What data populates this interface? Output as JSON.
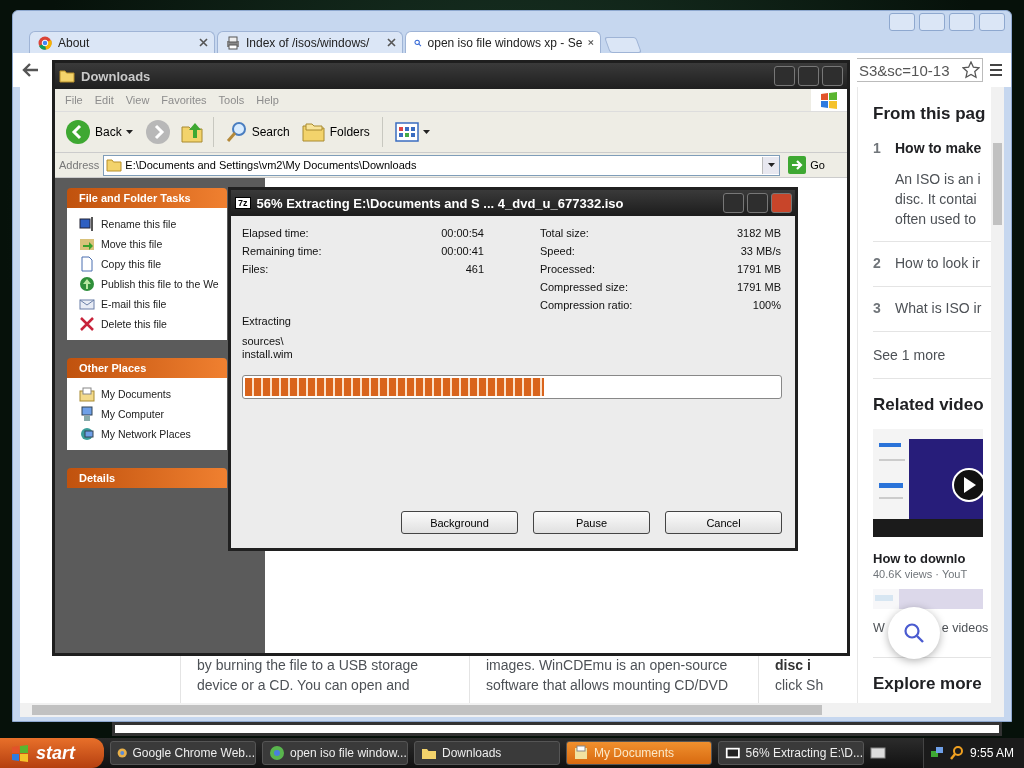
{
  "browser": {
    "tabs": [
      {
        "title": "About",
        "selected": false
      },
      {
        "title": "Index of /isos/windows/",
        "selected": false
      },
      {
        "title": "open iso file windows xp - Se",
        "selected": true
      }
    ],
    "address": "S3&sc=10-13",
    "page": {
      "snippets": [
        {
          "lines": [
            {
              "text": "by burning the file to a USB storage",
              "bold": false
            },
            {
              "text": "device or a CD. You can open and",
              "bold": false
            }
          ]
        },
        {
          "lines": [
            {
              "text": "images. WinCDEmu is an open-source",
              "bold": false
            },
            {
              "text": "software that allows mounting CD/DVD",
              "bold": false
            }
          ]
        },
        {
          "lines": [
            {
              "text": "disc i",
              "bold": true
            },
            {
              "text": "click Sh",
              "bold": false
            }
          ]
        }
      ],
      "sidebar": {
        "heading": "From this pag",
        "items": [
          {
            "number": "1",
            "title": "How to make",
            "expanded": true,
            "text": [
              "An ISO is an i",
              "disc. It contai",
              "often used to"
            ]
          },
          {
            "number": "2",
            "title": "How to look ir",
            "expanded": false
          },
          {
            "number": "3",
            "title": "What is ISO ir",
            "expanded": false
          }
        ],
        "more": "See 1 more",
        "videos_heading": "Related video",
        "video": {
          "kind": "picture",
          "title": "How to downlo",
          "meta": "40.6K views · YouT"
        },
        "videos_link": [
          "W",
          "e videos"
        ],
        "explore": "Explore more"
      }
    }
  },
  "explorer": {
    "title": "Downloads",
    "menu": [
      "File",
      "Edit",
      "View",
      "Favorites",
      "Tools",
      "Help"
    ],
    "toolbar": {
      "back": "Back",
      "search": "Search",
      "folders": "Folders"
    },
    "address_label": "Address",
    "address": "E:\\Documents and Settings\\vm2\\My Documents\\Downloads",
    "go": "Go",
    "panels": [
      {
        "title": "File and Folder Tasks",
        "items": [
          "Rename this file",
          "Move this file",
          "Copy this file",
          "Publish this file to the We",
          "E-mail this file",
          "Delete this file"
        ]
      },
      {
        "title": "Other Places",
        "items": [
          "My Documents",
          "My Computer",
          "My Network Places"
        ]
      },
      {
        "title": "Details"
      }
    ]
  },
  "dialog": {
    "badge": "7z",
    "title": "56% Extracting E:\\Documents and S ... 4_dvd_u_677332.iso",
    "stats_left": [
      {
        "label": "Elapsed time:",
        "value": "00:00:54"
      },
      {
        "label": "Remaining time:",
        "value": "00:00:41"
      },
      {
        "label": "Files:",
        "value": "461"
      }
    ],
    "stats_right": [
      {
        "label": "Total size:",
        "value": "3182 MB"
      },
      {
        "label": "Speed:",
        "value": "33 MB/s"
      },
      {
        "label": "Processed:",
        "value": "1791 MB"
      },
      {
        "label": "Compressed size:",
        "value": "1791 MB"
      },
      {
        "label": "Compression ratio:",
        "value": "100%"
      }
    ],
    "status": "Extracting",
    "path": [
      "sources\\",
      "install.wim"
    ],
    "progress": {
      "level": 0.56
    },
    "buttons": [
      "Background",
      "Pause",
      "Cancel"
    ]
  },
  "taskbar": {
    "start": "start",
    "items": [
      {
        "label": "Google Chrome Web...",
        "selected": false
      },
      {
        "label": "open iso file window...",
        "selected": false
      },
      {
        "label": "Downloads",
        "selected": false
      },
      {
        "label": "My Documents",
        "selected": true
      },
      {
        "label": "56% Extracting E:\\D...",
        "selected": false
      }
    ],
    "clock": "9:55 AM"
  }
}
